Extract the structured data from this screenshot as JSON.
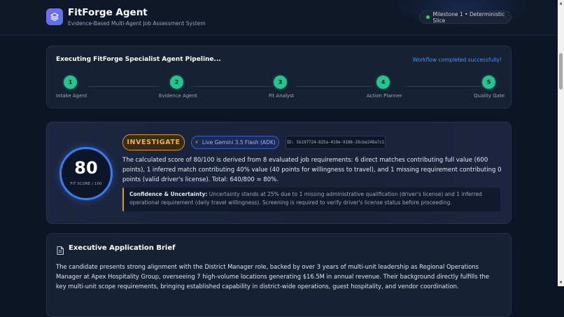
{
  "header": {
    "title": "FitForge Agent",
    "subtitle": "Evidence-Based Multi-Agent Job Assessment System",
    "milestone": "Milestone 1 • Deterministic Slice",
    "status_dot_color": "#2ecc71",
    "logo_icon": "layers-icon"
  },
  "pipeline": {
    "title": "Executing FitForge Specialist Agent Pipeline...",
    "status": "Workflow completed successfully!",
    "steps": [
      {
        "number": "1",
        "label": "Intake Agent"
      },
      {
        "number": "2",
        "label": "Evidence Agent"
      },
      {
        "number": "3",
        "label": "Fit Analyst"
      },
      {
        "number": "4",
        "label": "Action Planner"
      },
      {
        "number": "5",
        "label": "Quality Gate"
      }
    ],
    "step_color": "#27c48f"
  },
  "result": {
    "score": "80",
    "score_label": "FIT SCORE / 100",
    "verdict": "INVESTIGATE",
    "model_badge": "Live Gemini 3.5 Flash (ADK)",
    "run_id": "ID: 5b197724-825a-419e-9188-28cbe248a7c1",
    "explanation": "The calculated score of 80/100 is derived from 8 evaluated job requirements: 6 direct matches contributing full value (600 points), 1 inferred match contributing 40% value (40 points for willingness to travel), and 1 missing requirement contributing 0 points (valid driver's license). Total: 640/800 = 80%.",
    "confidence_label": "Confidence & Uncertainty:",
    "confidence_text": " Uncertainty stands at 25% due to 1 missing administrative qualification (driver's license) and 1 inferred operational requirement (daily travel willingness). Screening is required to verify driver's license status before proceeding.",
    "verdict_color": "#f2b441",
    "accent_color": "#3a7bf1"
  },
  "brief": {
    "title": "Executive Application Brief",
    "text": "The candidate presents strong alignment with the District Manager role, backed by over 3 years of multi-unit leadership as Regional Operations Manager at Apex Hospitality Group, overseeing 7 high-volume locations generating $16.5M in annual revenue. Their background directly fulfills the key multi-unit scope requirements, bringing established capability in district-wide operations, guest hospitality, and vendor coordination."
  }
}
